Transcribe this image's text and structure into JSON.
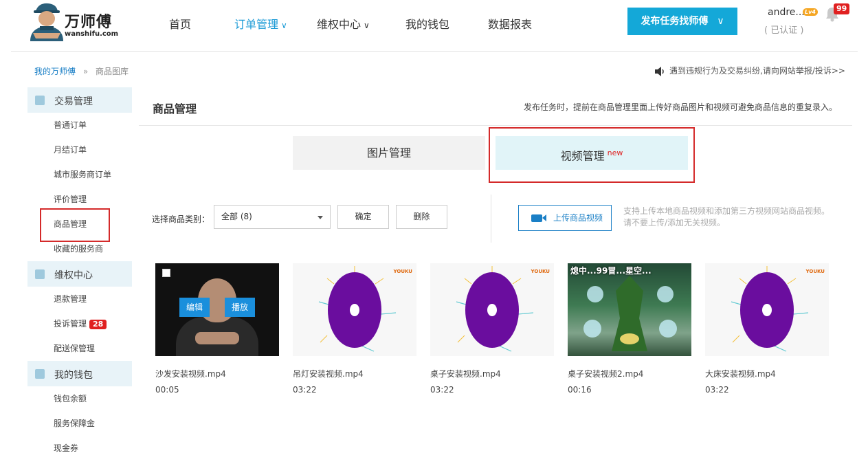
{
  "brand": {
    "name": "万师傅",
    "domain": "wanshifu.com"
  },
  "nav": {
    "items": [
      {
        "label": "首页",
        "chevron": false,
        "active": false
      },
      {
        "label": "订单管理",
        "chevron": true,
        "active": true
      },
      {
        "label": "维权中心",
        "chevron": true,
        "active": false
      },
      {
        "label": "我的钱包",
        "chevron": false,
        "active": false
      },
      {
        "label": "数据报表",
        "chevron": false,
        "active": false
      }
    ],
    "publish_button": "发布任务找师傅",
    "chevron_glyph": "∨"
  },
  "user": {
    "name": "andre...",
    "level": "Lv4",
    "status": "( 已认证 )",
    "notifications": "99"
  },
  "breadcrumb": {
    "home": "我的万师傅",
    "separator": "»",
    "current": "商品图库"
  },
  "notice": "遇到违规行为及交易纠纷,请向网站举报/投诉>>",
  "sidebar": {
    "groups": [
      {
        "label": "交易管理",
        "items": [
          {
            "label": "普通订单",
            "badge": ""
          },
          {
            "label": "月结订单",
            "badge": ""
          },
          {
            "label": "城市服务商订单",
            "badge": ""
          },
          {
            "label": "评价管理",
            "badge": ""
          },
          {
            "label": "商品管理",
            "badge": ""
          },
          {
            "label": "收藏的服务商",
            "badge": ""
          }
        ]
      },
      {
        "label": "维权中心",
        "items": [
          {
            "label": "退款管理",
            "badge": ""
          },
          {
            "label": "投诉管理",
            "badge": "28"
          },
          {
            "label": "配送保管理",
            "badge": ""
          }
        ]
      },
      {
        "label": "我的钱包",
        "items": [
          {
            "label": "钱包余额",
            "badge": ""
          },
          {
            "label": "服务保障金",
            "badge": ""
          },
          {
            "label": "现金券",
            "badge": ""
          }
        ]
      }
    ]
  },
  "main": {
    "title": "商品管理",
    "tip": "发布任务时，提前在商品管理里面上传好商品图片和视频可避免商品信息的重复录入。",
    "tabs": {
      "images": "图片管理",
      "videos": "视频管理",
      "new_tag": "new"
    },
    "filter": {
      "label": "选择商品类别：",
      "selected": "全部 (8)",
      "confirm": "确定",
      "delete": "删除"
    },
    "upload": {
      "button": "上传商品视频",
      "tip_line1": "支持上传本地商品视频和添加第三方视频网站商品视频。",
      "tip_line2": "请不要上传/添加无关视频。"
    },
    "videos": [
      {
        "name": "沙发安装视频.mp4",
        "duration": "00:05",
        "thumb": "person",
        "edit": "编辑",
        "play": "播放"
      },
      {
        "name": "吊灯安装视频.mp4",
        "duration": "03:22",
        "thumb": "youku",
        "watermark": "YOUKU"
      },
      {
        "name": "桌子安装视频.mp4",
        "duration": "03:22",
        "thumb": "youku",
        "watermark": "YOUKU"
      },
      {
        "name": "桌子安装视频2.mp4",
        "duration": "00:16",
        "thumb": "game",
        "overlay": "熄中...99冒...星空..."
      },
      {
        "name": "大床安装视频.mp4",
        "duration": "03:22",
        "thumb": "youku",
        "watermark": "YOUKU"
      }
    ]
  },
  "colors": {
    "accent": "#1a9ad6",
    "publish_bg": "#14a8d8",
    "highlight": "#d42a2a",
    "badge": "#e02020",
    "disc": "#6a0d9e"
  }
}
